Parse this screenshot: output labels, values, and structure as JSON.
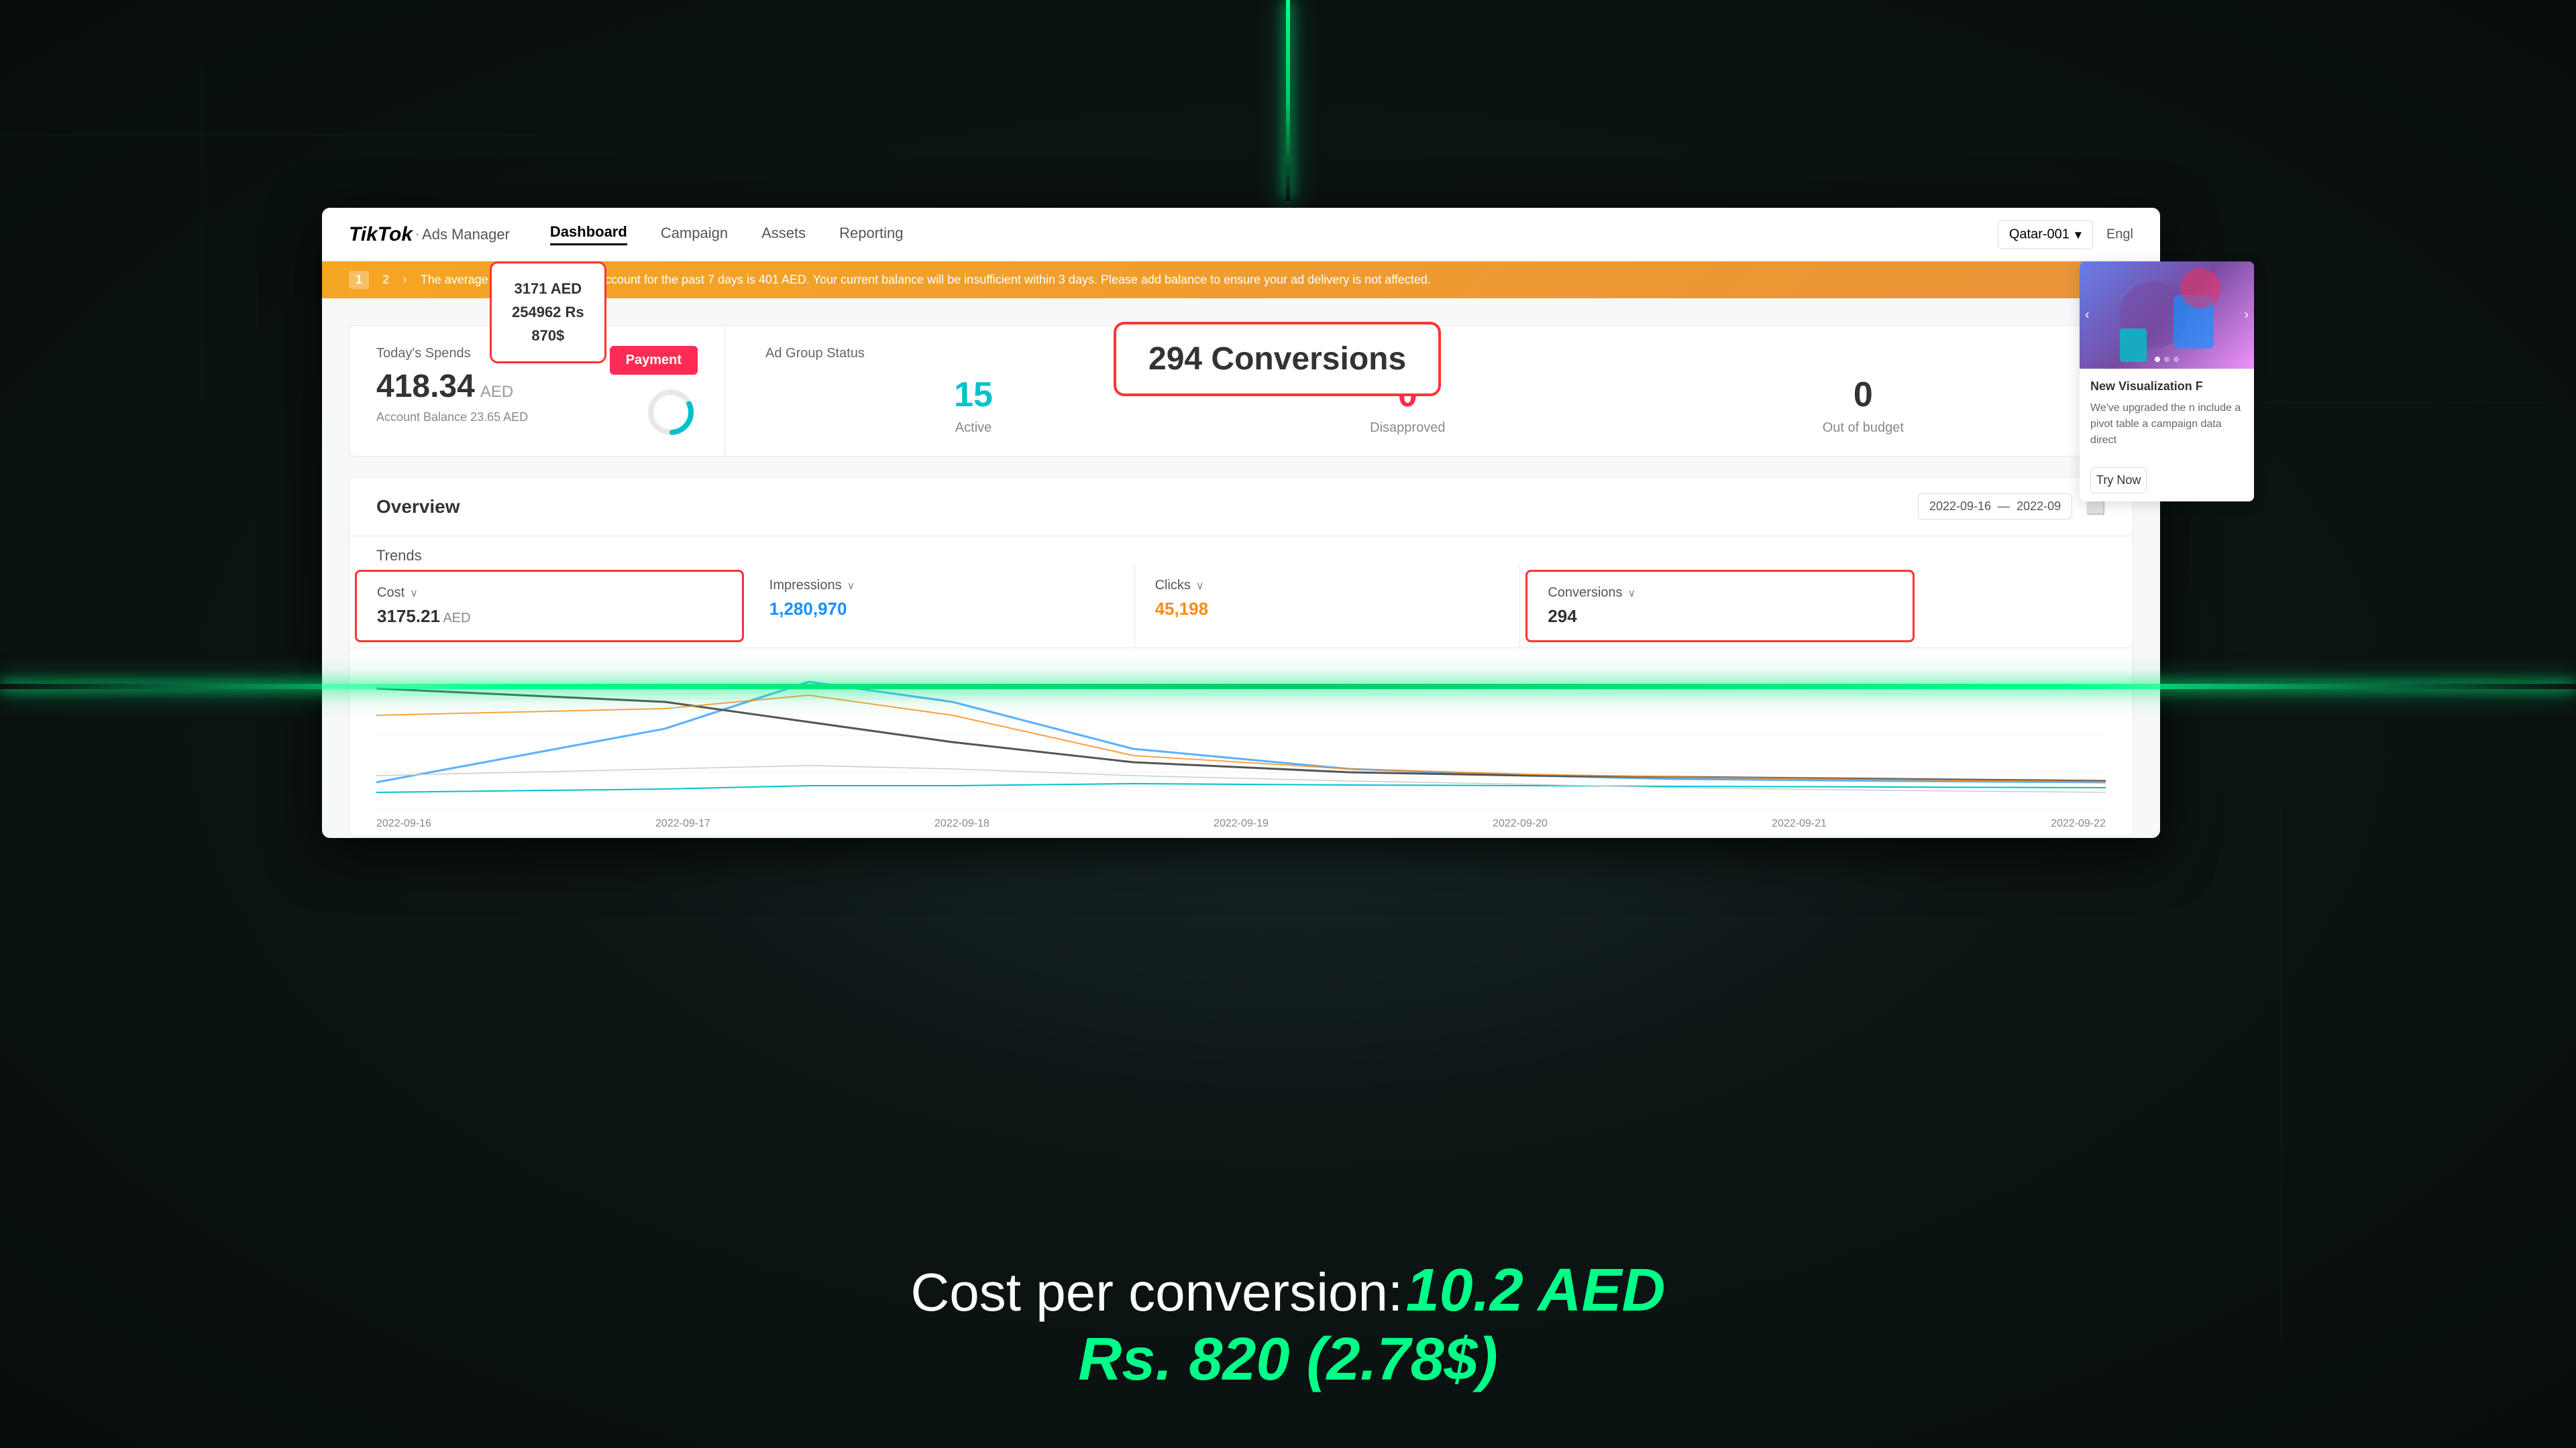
{
  "background": {
    "color": "#0d1515"
  },
  "nav": {
    "brand": "TikTok",
    "brand_sub": "Ads Manager",
    "links": [
      "Dashboard",
      "Campaign",
      "Assets",
      "Reporting"
    ],
    "active_link": "Dashboard",
    "country": "Qatar-001",
    "language": "Engl"
  },
  "warning": {
    "pages": [
      "1",
      "2"
    ],
    "text": "The average spending from your account for the past 7 days is 401 AED. Your current balance will be insufficient within 3 days. Please add balance to ensure your ad delivery is not affected."
  },
  "todays_spends": {
    "label": "Today's Spends",
    "amount": "418.34",
    "currency": "AED",
    "account_balance": "Account Balance 23.65 AED",
    "payment_btn": "Payment"
  },
  "ad_group_status": {
    "label": "Ad Group Status",
    "active": {
      "value": "15",
      "label": "Active"
    },
    "disapproved": {
      "value": "0",
      "label": "Disapproved"
    },
    "out_of_budget": {
      "value": "0",
      "label": "Out of budget"
    }
  },
  "overview": {
    "title": "Overview",
    "date_start": "2022-09-16",
    "date_end": "2022-09",
    "callout": {
      "line1": "3171 AED",
      "line2": "254962 Rs",
      "line3": "870$"
    }
  },
  "trends": {
    "label": "Trends",
    "metrics": [
      {
        "name": "Cost",
        "value": "3175.21",
        "unit": "AED",
        "highlighted": true,
        "color": "#333"
      },
      {
        "name": "Impressions",
        "value": "1,280,970",
        "unit": "",
        "highlighted": false,
        "color": "#1890ff"
      },
      {
        "name": "Clicks",
        "value": "45,198",
        "unit": "",
        "highlighted": false,
        "color": "#fa8c16"
      },
      {
        "name": "Conversions",
        "value": "294",
        "unit": "",
        "highlighted": true,
        "color": "#333"
      }
    ],
    "chart_dates": [
      "2022-09-16",
      "2022-09-17",
      "2022-09-18",
      "2022-09-19",
      "2022-09-20",
      "2022-09-21",
      "2022-09-22"
    ]
  },
  "conversions_callout": "294 Conversions",
  "sidebar_card": {
    "title": "New Visualization F",
    "text": "We've upgraded the n include a pivot table a campaign data direct",
    "btn": "Try Now"
  },
  "bottom_text": {
    "label": "Cost per conversion:",
    "value": "10.2 AED",
    "value2": "Rs. 820 (2.78$)"
  }
}
